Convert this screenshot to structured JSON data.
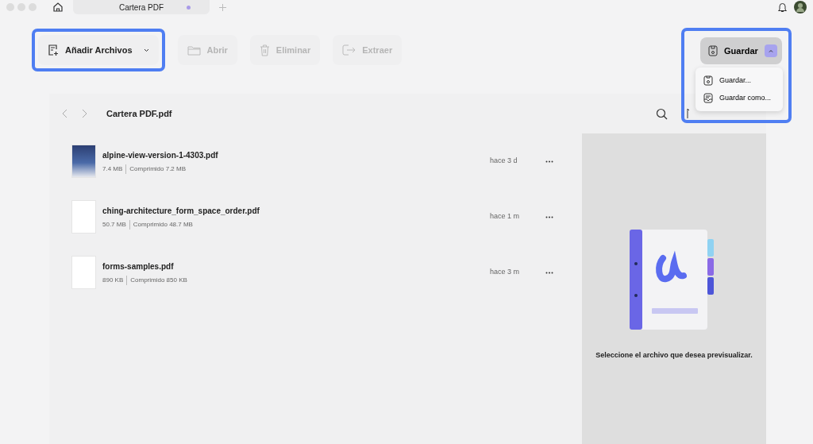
{
  "window": {
    "tab": {
      "title": "Cartera PDF",
      "unsaved": true
    }
  },
  "toolbar": [
    {
      "kind": "add",
      "label": "Añadir Archivos",
      "disabled": false,
      "highlighted": true,
      "dropdown": true
    },
    {
      "kind": "open",
      "label": "Abrir",
      "disabled": true,
      "highlighted": false,
      "dropdown": false
    },
    {
      "kind": "delete",
      "label": "Eliminar",
      "disabled": true,
      "highlighted": false,
      "dropdown": false
    },
    {
      "kind": "extract",
      "label": "Extraer",
      "disabled": true,
      "highlighted": false,
      "dropdown": false
    }
  ],
  "save": {
    "label": "Guardar",
    "expanded": true,
    "highlighted": true,
    "menu": [
      {
        "kind": "save",
        "label": "Guardar..."
      },
      {
        "kind": "save_as",
        "label": "Guardar como..."
      }
    ]
  },
  "header": {
    "title": "Cartera PDF.pdf"
  },
  "files": [
    {
      "kind": "cover",
      "name": "alpine-view-version-1-4303.pdf",
      "size": "7.4 MB",
      "compressed": "Comprimido 7.2 MB",
      "modified": "hace 3 d"
    },
    {
      "kind": "page",
      "name": "ching-architecture_form_space_order.pdf",
      "size": "50.7 MB",
      "compressed": "Comprimido 48.7 MB",
      "modified": "hace 1 m"
    },
    {
      "kind": "page",
      "name": "forms-samples.pdf",
      "size": "890 KB",
      "compressed": "Comprimido 850 KB",
      "modified": "hace 3 m"
    }
  ],
  "preview": {
    "message": "Seleccione el archivo que desea previsualizar."
  }
}
